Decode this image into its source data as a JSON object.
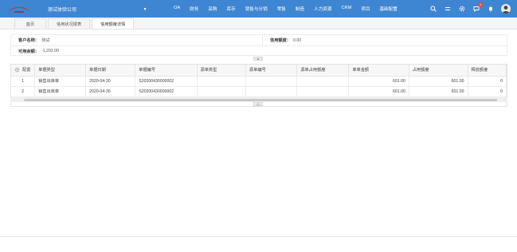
{
  "header": {
    "company": "测试体验公司",
    "nav": [
      "OA",
      "财务",
      "采购",
      "库存",
      "销售与分销",
      "零售",
      "制造",
      "人力资源",
      "CRM",
      "项目",
      "基础配置"
    ],
    "notification_count": "1",
    "icons": [
      "search-icon",
      "menu-icon",
      "gear-icon",
      "chat-icon",
      "bell-icon",
      "avatar"
    ]
  },
  "tabs": [
    "首页",
    "信用状况报表",
    "信用额度详情"
  ],
  "info": {
    "customer_label": "客户名称：",
    "customer_value": "测试",
    "credit_label": "信用额度：",
    "credit_value": "0.00",
    "available_label": "可用余额：",
    "available_value": "-1,202.00"
  },
  "grid": {
    "settings_label": "配置",
    "columns": [
      "单据类型",
      "单据日期",
      "单据编号",
      "源单类型",
      "源单编号",
      "源单占用额度",
      "单单金额",
      "占用额度",
      "释放额度"
    ],
    "rows": [
      {
        "index": "1",
        "type": "销售出库单",
        "date": "2020-04-30",
        "code": "S20200430000002",
        "src_type": "",
        "src_code": "",
        "src_amount": "",
        "amount": "601.00",
        "occupied": "601.00",
        "released": "0"
      },
      {
        "index": "2",
        "type": "销售出库单",
        "date": "2020-04-30",
        "code": "S20200430000002",
        "src_type": "",
        "src_code": "",
        "src_amount": "",
        "amount": "601.00",
        "occupied": "601.00",
        "released": "0"
      }
    ]
  },
  "colors": {
    "header_bg": "#3f86d2",
    "badge": "#e84a3c",
    "logo": "#c0392b"
  }
}
